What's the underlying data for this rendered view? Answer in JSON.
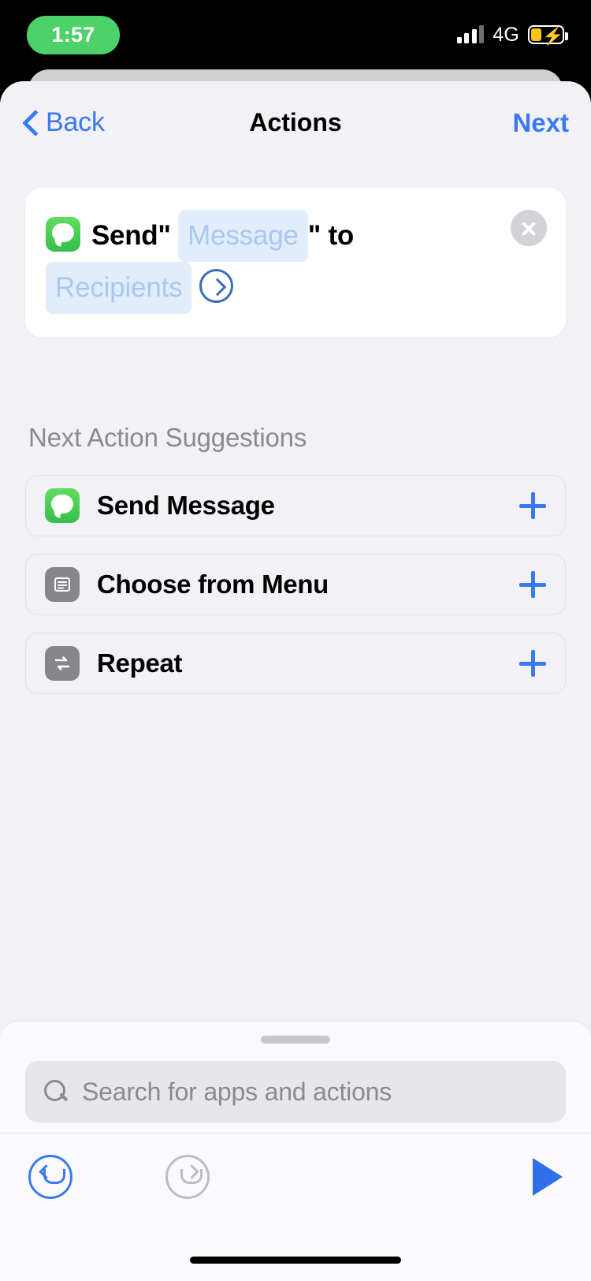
{
  "status_bar": {
    "time": "1:57",
    "network": "4G",
    "signal_icon": "signal-bars-icon",
    "battery_icon": "battery-charging-icon",
    "time_pill_color": "#4CD268",
    "battery_color": "#F5C518"
  },
  "nav": {
    "back_label": "Back",
    "back_icon": "chevron-left-icon",
    "title": "Actions",
    "next_label": "Next",
    "accent_color": "#3a7af0"
  },
  "action_card": {
    "app_icon": "messages-app-icon",
    "verb": "Send",
    "open_quote": "\"",
    "message_placeholder": "Message",
    "close_quote": "\"",
    "preposition": "to",
    "recipients_placeholder": "Recipients",
    "detail_icon": "chevron-right-circle-icon",
    "remove_icon": "close-circle-icon",
    "pill_bg": "#e2edfb",
    "pill_text_color": "#a8c8ef"
  },
  "suggestions_section": {
    "title": "Next Action Suggestions",
    "items": [
      {
        "label": "Send Message",
        "icon": "messages-app-icon",
        "icon_style": "green",
        "add_icon": "plus-icon"
      },
      {
        "label": "Choose from Menu",
        "icon": "menu-list-icon",
        "icon_style": "gray",
        "add_icon": "plus-icon"
      },
      {
        "label": "Repeat",
        "icon": "repeat-loop-icon",
        "icon_style": "gray",
        "add_icon": "plus-icon"
      }
    ]
  },
  "bottom_sheet": {
    "grabber_icon": "drag-handle-icon",
    "search": {
      "icon": "search-icon",
      "value": "",
      "placeholder": "Search for apps and actions"
    }
  },
  "toolbar": {
    "undo_icon": "undo-icon",
    "undo_enabled": "true",
    "redo_icon": "redo-icon",
    "redo_enabled": "false",
    "run_icon": "play-icon",
    "run_color": "#2F6FE8"
  }
}
